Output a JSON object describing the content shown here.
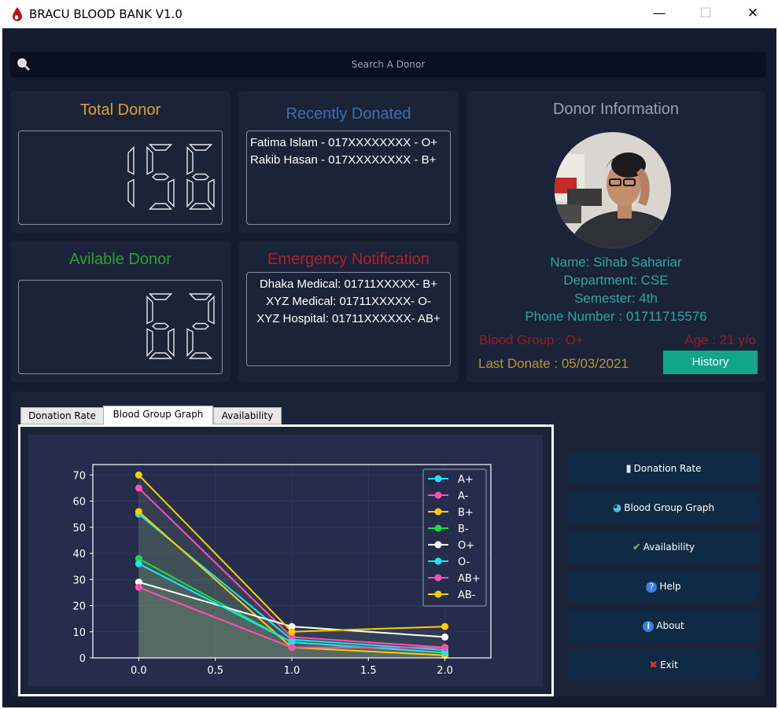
{
  "window": {
    "title": "BRACU BLOOD BANK V1.0",
    "controls": {
      "minimize": "—",
      "maximize": "☐",
      "close": "✕"
    }
  },
  "search": {
    "placeholder": "Search A Donor"
  },
  "total_donor": {
    "title": "Total Donor",
    "value": "156"
  },
  "available_donor": {
    "title": "Avilable Donor",
    "value": "62"
  },
  "recently_donated": {
    "title": "Recently Donated",
    "items": [
      "Fatima Islam - 017XXXXXXXX - O+",
      "Rakib Hasan - 017XXXXXXXX - B+"
    ]
  },
  "emergency": {
    "title": "Emergency Notification",
    "items": [
      "Dhaka Medical: 01711XXXXX- B+",
      "XYZ Medical: 01711XXXXX- O-",
      "XYZ Hospital: 01711XXXXXX- AB+"
    ]
  },
  "donor_info": {
    "title": "Donor Information",
    "name": "Name: Sihab Sahariar",
    "department": "Department: CSE",
    "semester": "Semester: 4th",
    "phone": "Phone Number : 01711715576",
    "blood_group": "Blood Group : O+",
    "age": "Age : 21 y/o",
    "last_donate": "Last Donate : 05/03/2021",
    "history_label": "History"
  },
  "tabs": [
    {
      "label": "Donation Rate",
      "active": false
    },
    {
      "label": "Blood Group Graph",
      "active": true
    },
    {
      "label": "Availability",
      "active": false
    }
  ],
  "side_buttons": [
    {
      "label": "Donation Rate",
      "icon": "book-icon"
    },
    {
      "label": "Blood Group Graph",
      "icon": "pie-chart-icon"
    },
    {
      "label": "Availability",
      "icon": "checkmark-icon"
    },
    {
      "label": "Help",
      "icon": "help-icon"
    },
    {
      "label": "About",
      "icon": "info-icon"
    },
    {
      "label": "Exit",
      "icon": "exit-icon"
    }
  ],
  "colors": {
    "background": "#141b2f",
    "panel": "#1b2339",
    "total_title": "#e0a030",
    "available_title": "#2ca02c",
    "recent_title": "#3a6fb0",
    "emergency_title": "#b3202a",
    "info_text": "#2fa6a6",
    "blood_group_text": "#9b1c22",
    "last_donate_text": "#b8962e",
    "history_button": "#12a58a"
  },
  "chart_data": {
    "type": "line",
    "x": [
      0.0,
      1.0,
      2.0
    ],
    "xticks": [
      "0.0",
      "0.5",
      "1.0",
      "1.5",
      "2.0"
    ],
    "yticks": [
      "0",
      "10",
      "20",
      "30",
      "40",
      "50",
      "60",
      "70"
    ],
    "xlim": [
      -0.3,
      2.3
    ],
    "ylim": [
      0,
      74
    ],
    "grid": true,
    "legend": "top-right",
    "series": [
      {
        "name": "A+",
        "values": [
          55,
          7,
          3
        ],
        "color": "#22e0f0"
      },
      {
        "name": "A-",
        "values": [
          65,
          8,
          4
        ],
        "color": "#ff4fb2"
      },
      {
        "name": "B+",
        "values": [
          56,
          4,
          1
        ],
        "color": "#ffcc00"
      },
      {
        "name": "B-",
        "values": [
          38,
          6,
          2
        ],
        "color": "#12e048"
      },
      {
        "name": "O+",
        "values": [
          29,
          12,
          8
        ],
        "color": "#ffffff"
      },
      {
        "name": "O-",
        "values": [
          36,
          6,
          2
        ],
        "color": "#22e0f0"
      },
      {
        "name": "AB+",
        "values": [
          27,
          4,
          4
        ],
        "color": "#ff4fb2"
      },
      {
        "name": "AB-",
        "values": [
          70,
          10,
          12
        ],
        "color": "#ffcc00"
      }
    ]
  }
}
